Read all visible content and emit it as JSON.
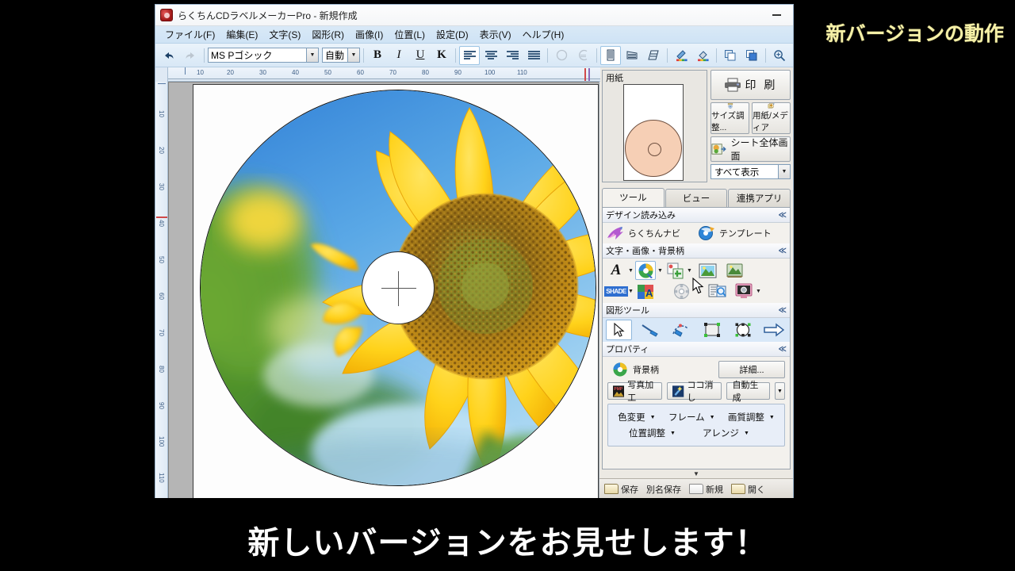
{
  "overlay": {
    "corner_caption": "新バージョンの動作",
    "subtitle": "新しいバージョンをお見せします！",
    "caption_color": "#f5f0a8",
    "subtitle_color": "#ffffff",
    "background_color": "#000000"
  },
  "window": {
    "title": "らくちんCDラベルメーカーPro - 新規作成",
    "app_icon": "app-icon",
    "minimize_label": "—"
  },
  "menubar": {
    "items": [
      {
        "label": "ファイル(F)",
        "name": "menu-file"
      },
      {
        "label": "編集(E)",
        "name": "menu-edit"
      },
      {
        "label": "文字(S)",
        "name": "menu-text"
      },
      {
        "label": "図形(R)",
        "name": "menu-shape"
      },
      {
        "label": "画像(I)",
        "name": "menu-image"
      },
      {
        "label": "位置(L)",
        "name": "menu-position"
      },
      {
        "label": "設定(D)",
        "name": "menu-settings"
      },
      {
        "label": "表示(V)",
        "name": "menu-view"
      },
      {
        "label": "ヘルプ(H)",
        "name": "menu-help"
      }
    ]
  },
  "toolbar": {
    "undo_icon": "undo-icon",
    "redo_icon": "redo-icon",
    "font_name": "MS Pゴシック",
    "font_size": "自動",
    "bold_label": "B",
    "italic_label": "I",
    "underline_label": "U",
    "kerning_label": "K",
    "align_left_icon": "align-left-icon",
    "align_center_icon": "align-center-icon",
    "align_right_icon": "align-right-icon",
    "align_justify_icon": "align-justify-icon",
    "circle_text_icon": "circle-text-icon",
    "arc_text_icon": "arc-text-icon",
    "vertical_text_icon": "vertical-text-icon",
    "slant1_icon": "slant-text-icon-1",
    "slant2_icon": "slant-text-icon-2",
    "pen_color_icon": "pen-color-icon",
    "fill_color_icon": "fill-color-icon",
    "bring_front_icon": "bring-to-front-icon",
    "send_back_icon": "send-to-back-icon",
    "zoom_icon": "zoom-icon"
  },
  "canvas": {
    "ruler_h_ticks": [
      "10",
      "20",
      "30",
      "40",
      "50",
      "60",
      "70",
      "80",
      "90",
      "100",
      "110"
    ],
    "ruler_v_ticks": [
      "10",
      "20",
      "30",
      "40",
      "50",
      "60",
      "70",
      "80",
      "90",
      "100",
      "110"
    ],
    "unit": "mm",
    "artwork": "sunflower-photo",
    "hub_marker": "center-crosshair"
  },
  "paper_panel": {
    "title": "用紙",
    "preview_name": "paper-preview",
    "print_button": "印 刷",
    "size_adjust_button": "サイズ調整...",
    "paper_media_button": "用紙/メディア",
    "sheet_full_button": "シート全体画面",
    "display_filter_value": "すべて表示"
  },
  "tabs": [
    {
      "label": "ツール",
      "name": "tab-tools",
      "active": true
    },
    {
      "label": "ビュー",
      "name": "tab-view",
      "active": false
    },
    {
      "label": "連携アプリ",
      "name": "tab-linked-apps",
      "active": false
    }
  ],
  "sections": {
    "design_load": {
      "title": "デザイン読み込み",
      "items": [
        {
          "label": "らくちんナビ",
          "icon": "rakuchin-navi-icon"
        },
        {
          "label": "テンプレート",
          "icon": "template-icon"
        }
      ]
    },
    "text_image_bg": {
      "title": "文字・画像・背景柄",
      "row1": [
        {
          "icon": "text-tool-icon",
          "label": "A",
          "has_dropdown": true
        },
        {
          "icon": "background-pattern-icon",
          "label": "",
          "has_dropdown": true,
          "selected": true
        },
        {
          "icon": "clipart-icon",
          "label": "",
          "has_dropdown": true
        },
        {
          "icon": "photo-icon",
          "label": "",
          "has_dropdown": false
        },
        {
          "icon": "photo-frame-icon",
          "label": "",
          "has_dropdown": false
        }
      ],
      "row2": [
        {
          "icon": "shade-icon",
          "label": "SHADE",
          "has_dropdown": true
        },
        {
          "icon": "word-art-icon",
          "label": "",
          "has_dropdown": false
        },
        {
          "icon": "disc-menu-icon",
          "label": "",
          "has_dropdown": false
        },
        {
          "icon": "list-preview-icon",
          "label": "",
          "has_dropdown": false
        },
        {
          "icon": "screen-capture-icon",
          "label": "",
          "has_dropdown": true
        }
      ]
    },
    "shape_tools": {
      "title": "図形ツール",
      "items": [
        {
          "icon": "select-arrow-icon",
          "selected": true
        },
        {
          "icon": "line-tool-icon",
          "selected": false
        },
        {
          "icon": "curve-tool-icon",
          "selected": false
        },
        {
          "icon": "rectangle-tool-icon",
          "selected": false
        },
        {
          "icon": "ellipse-tool-icon",
          "selected": false
        },
        {
          "icon": "arrow-shape-icon",
          "selected": false
        }
      ]
    },
    "properties": {
      "title": "プロパティ",
      "object_icon": "background-pattern-icon",
      "object_label": "背景柄",
      "detail_button": "詳細...",
      "photo_edit_button": "写真加工",
      "photo_edit_icon": "pmp-icon",
      "erase_button": "ココ消し",
      "erase_icon": "magic-erase-icon",
      "auto_generate_button": "自動生成",
      "menu_items": [
        {
          "label": "色変更",
          "name": "color-change-menu"
        },
        {
          "label": "フレーム",
          "name": "frame-menu"
        },
        {
          "label": "画質調整",
          "name": "image-quality-menu"
        },
        {
          "label": "位置調整",
          "name": "position-adjust-menu"
        },
        {
          "label": "アレンジ",
          "name": "arrange-menu"
        }
      ]
    }
  },
  "bottom_bar": {
    "items": [
      {
        "label": "保存",
        "icon": "save-icon"
      },
      {
        "label": "別名保存",
        "icon": "save-as-icon"
      },
      {
        "label": "新規",
        "icon": "new-icon"
      },
      {
        "label": "開く",
        "icon": "open-icon"
      }
    ]
  }
}
